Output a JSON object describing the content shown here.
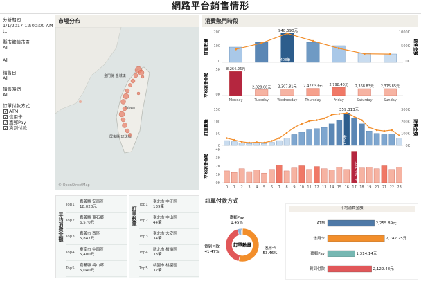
{
  "title": "網路平台銷售情形",
  "filters": [
    {
      "label": "分析期間",
      "value": "1/1/2017 12:00:00 AM t..."
    },
    {
      "label": "縣市鄉鎮市區",
      "value": "All"
    },
    {
      "label": "",
      "value": "All"
    },
    {
      "label": "銷售日",
      "value": "All"
    },
    {
      "label": "銷售時間",
      "value": "All"
    },
    {
      "label": "訂單付款方式",
      "value": ""
    }
  ],
  "payment_checks": [
    "ATM",
    "信用卡",
    "嘉郵Pay",
    "貨到付款"
  ],
  "map": {
    "header": "市場分布",
    "labels": [
      "金門縣 金城鎮",
      "嘉義縣 民雄鄉",
      "屏東縣 琉球鄉",
      "Taiwan"
    ]
  },
  "hot_hours": {
    "header": "消費熱門時段",
    "upper_left_label": "訂單數量",
    "upper_right_label": "銷售金額",
    "lower_left_label": "平均消費金額",
    "y_ticks_upper_left": [
      "200",
      "100",
      "0"
    ],
    "y_ticks_upper_right": [
      "1000K",
      "500K",
      "0K"
    ],
    "y_ticks_lower": [
      "5K",
      "0K"
    ],
    "top_annotation": "948,590元",
    "bar_annotation": "408筆"
  },
  "weekday_chart": {
    "days": [
      "Monday",
      "Tuesday",
      "Wednesday",
      "Thursday",
      "Friday",
      "Saturday",
      "Sunday"
    ],
    "orders": [
      110,
      145,
      210,
      145,
      120,
      65,
      60
    ],
    "sales_k": [
      430,
      630,
      948.59,
      700,
      460,
      280,
      270
    ],
    "avg_labels": [
      "8,264.26元",
      "2,028.08元",
      "2,307.81元",
      "2,472.53元",
      "2,798.40元",
      "2,368.83元",
      "2,375.85元"
    ],
    "avg_values": [
      8264.26,
      2028.08,
      2307.81,
      2472.53,
      2798.4,
      2368.83,
      2375.85
    ]
  },
  "hour_chart": {
    "hours": [
      "0",
      "1",
      "2",
      "3",
      "4",
      "5",
      "6",
      "7",
      "8",
      "9",
      "10",
      "11",
      "12",
      "13",
      "14",
      "15",
      "16",
      "17",
      "18",
      "19",
      "20",
      "21",
      "22",
      "23"
    ],
    "orders": [
      20,
      15,
      10,
      8,
      10,
      8,
      12,
      20,
      30,
      45,
      55,
      65,
      70,
      75,
      90,
      105,
      135,
      115,
      90,
      60,
      50,
      45,
      48,
      30
    ],
    "sales_k": [
      80,
      60,
      40,
      30,
      35,
      30,
      50,
      80,
      140,
      200,
      240,
      270,
      280,
      300,
      340,
      350,
      359.3,
      320,
      280,
      200,
      170,
      160,
      170,
      110
    ],
    "avg_values": [
      1600,
      1400,
      1900,
      1500,
      1700,
      1300,
      1800,
      2400,
      1600,
      2000,
      2300,
      1800,
      2200,
      1900,
      1700,
      2100,
      1800,
      4266.31,
      2000,
      2100,
      1900,
      2300,
      1800,
      2100
    ],
    "annotation_top": "359,313元",
    "annotation_bar": "135筆",
    "annotation_avg": "4,266.31元",
    "y_ticks_upper_left": [
      "150",
      "100",
      "50",
      "0"
    ],
    "y_ticks_upper_right": [
      "300K",
      "200K",
      "100K",
      "0K"
    ],
    "y_ticks_lower": [
      "4K",
      "3K",
      "2K",
      "1K",
      "0K"
    ],
    "left_label_upper": "訂單數量",
    "left_label_lower": "平均消費金額",
    "right_label": "銷售金額"
  },
  "avg_table": {
    "title": "平均消費金額",
    "rows": [
      {
        "rank": "Top1",
        "name": "嘉義縣 安南區",
        "value": "18,028元"
      },
      {
        "rank": "Top2",
        "name": "嘉義縣 東石鄉",
        "value": "6,570元"
      },
      {
        "rank": "Top3",
        "name": "嘉義市 西區",
        "value": "5,847元"
      },
      {
        "rank": "Top4",
        "name": "臺南市 中西區",
        "value": "5,400元"
      },
      {
        "rank": "Top5",
        "name": "嘉義縣 梅山鄉",
        "value": "5,040元"
      }
    ]
  },
  "order_table": {
    "title": "訂單數量",
    "rows": [
      {
        "rank": "Top1",
        "name": "臺北市 中正區",
        "value": "139筆"
      },
      {
        "rank": "Top2",
        "name": "臺北市 中山區",
        "value": "44筆"
      },
      {
        "rank": "Top3",
        "name": "臺北市 大安區",
        "value": "34筆"
      },
      {
        "rank": "Top4",
        "name": "新北市 板橋區",
        "value": "33筆"
      },
      {
        "rank": "Top5",
        "name": "桃園市 桃園區",
        "value": "32筆"
      }
    ]
  },
  "payment": {
    "header": "訂單付款方式",
    "donut_center": "訂單數量",
    "slices": [
      {
        "name": "嘉郵Pay",
        "pct": 1.45,
        "label": "1.45%",
        "color": "#4e79a7"
      },
      {
        "name": "信用卡",
        "pct": 53.46,
        "label": "53.46%",
        "color": "#f28e2b"
      },
      {
        "name": "貨到付款",
        "pct": 41.47,
        "label": "41.47%",
        "color": "#e15759"
      },
      {
        "name": "ATM",
        "pct": 3.62,
        "label": "",
        "color": "#8fb3d9"
      }
    ],
    "bar_header": "平均消費金額",
    "bars": [
      {
        "name": "ATM",
        "value": 2255.89,
        "label": "2,255.89元",
        "color": "#4e79a7"
      },
      {
        "name": "信用卡",
        "value": 2742.25,
        "label": "2,742.25元",
        "color": "#f28e2b"
      },
      {
        "name": "嘉郵Pay",
        "value": 1314.14,
        "label": "1,314.14元",
        "color": "#76b7b2"
      },
      {
        "name": "貨到付款",
        "value": 2122.48,
        "label": "2,122.48元",
        "color": "#e15759"
      }
    ]
  },
  "chart_data": [
    {
      "type": "bar",
      "title": "消費熱門時段",
      "categories": [
        "Monday",
        "Tuesday",
        "Wednesday",
        "Thursday",
        "Friday",
        "Saturday",
        "Sunday"
      ],
      "series": [
        {
          "name": "平均消費金額",
          "values": [
            8264.26,
            2028.08,
            2307.81,
            2472.53,
            2798.4,
            2368.83,
            2375.85
          ]
        }
      ]
    },
    {
      "type": "bar",
      "title": "平均消費金額",
      "categories": [
        "ATM",
        "信用卡",
        "嘉郵Pay",
        "貨到付款"
      ],
      "values": [
        2255.89,
        2742.25,
        1314.14,
        2122.48
      ]
    },
    {
      "type": "pie",
      "title": "訂單數量",
      "categories": [
        "嘉郵Pay",
        "信用卡",
        "貨到付款",
        "ATM"
      ],
      "values": [
        1.45,
        53.46,
        41.47,
        3.62
      ]
    }
  ]
}
